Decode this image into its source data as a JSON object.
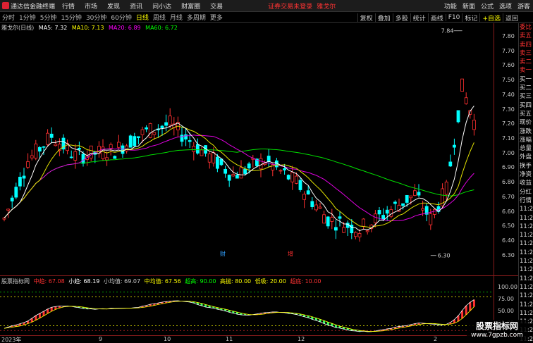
{
  "app": {
    "title": "通达信金融终端",
    "menus": [
      "行情",
      "市场",
      "发现",
      "资讯",
      "问小达",
      "财富圈",
      "交易"
    ],
    "notice": "证券交易未登录",
    "security_name": "雅戈尔",
    "right_links": [
      "功能",
      "新面",
      "公式",
      "选项",
      "游客"
    ]
  },
  "timeframes": {
    "items": [
      "分时",
      "1分钟",
      "5分钟",
      "15分钟",
      "30分钟",
      "60分钟",
      "日线",
      "周线",
      "月线",
      "多周期",
      "更多"
    ],
    "active": "日线",
    "tools": [
      "复权",
      "叠加",
      "多股",
      "统计",
      "画线",
      "F10",
      "标记",
      "+自选",
      "返回"
    ]
  },
  "legend": {
    "security": "雅戈尔(日线)",
    "ma5": "MA5: 7.32",
    "ma10": "MA10: 7.13",
    "ma20": "MA20: 6.89",
    "ma60": "MA60: 6.72"
  },
  "colors": {
    "ma5": "#ffffff",
    "ma10": "#ffff00",
    "ma20": "#ff00ff",
    "ma60": "#00ff00",
    "up": "#ff3030",
    "down": "#00ffff"
  },
  "annotations": {
    "high": "7.84",
    "low": "6.30",
    "marker1": "财",
    "marker2": "增"
  },
  "right_panel": [
    "委比",
    "卖五",
    "卖四",
    "卖三",
    "卖二",
    "卖一",
    "买一",
    "买二",
    "买三",
    "买四",
    "买五",
    "现价",
    "涨跌",
    "涨幅",
    "总量",
    "外盘",
    "换手",
    "净资",
    "收益",
    "分红",
    "行情",
    "11:2",
    "11:2",
    "11:2",
    "11:2",
    "11:2",
    "11:2",
    "11:2",
    "11:2",
    "11:2",
    "11:2",
    "11:2",
    "11:2",
    "11:2",
    "11:2",
    "11:2",
    "11:2"
  ],
  "indicator": {
    "name": "股票指标网",
    "items": [
      {
        "label": "中趋: 67.08",
        "color": "#ff3030"
      },
      {
        "label": "小趋: 68.19",
        "color": "#ffffff"
      },
      {
        "label": "小均值: 69.07",
        "color": "#cccccc"
      },
      {
        "label": "中均值: 67.56",
        "color": "#ffff00"
      },
      {
        "label": "超高: 90.00",
        "color": "#00ff00"
      },
      {
        "label": "高抛: 80.00",
        "color": "#ffff00"
      },
      {
        "label": "低吸: 20.00",
        "color": "#ffff00"
      },
      {
        "label": "超底: 10.00",
        "color": "#ff3030"
      }
    ]
  },
  "y_ticks_main": [
    "7.80",
    "7.70",
    "7.60",
    "7.50",
    "7.40",
    "7.30",
    "7.20",
    "7.10",
    "7.00",
    "6.90",
    "6.80",
    "6.70",
    "6.60",
    "6.50",
    "6.40",
    "6.30"
  ],
  "y_ticks_ind": [
    "100.00",
    "75.00",
    "50.00",
    "25.00"
  ],
  "x_labels": [
    "2023年",
    "9",
    "10",
    "11",
    "12",
    "2"
  ],
  "watermark": {
    "line1": "股票指标网",
    "line2": "www.7gpzb.com"
  }
}
